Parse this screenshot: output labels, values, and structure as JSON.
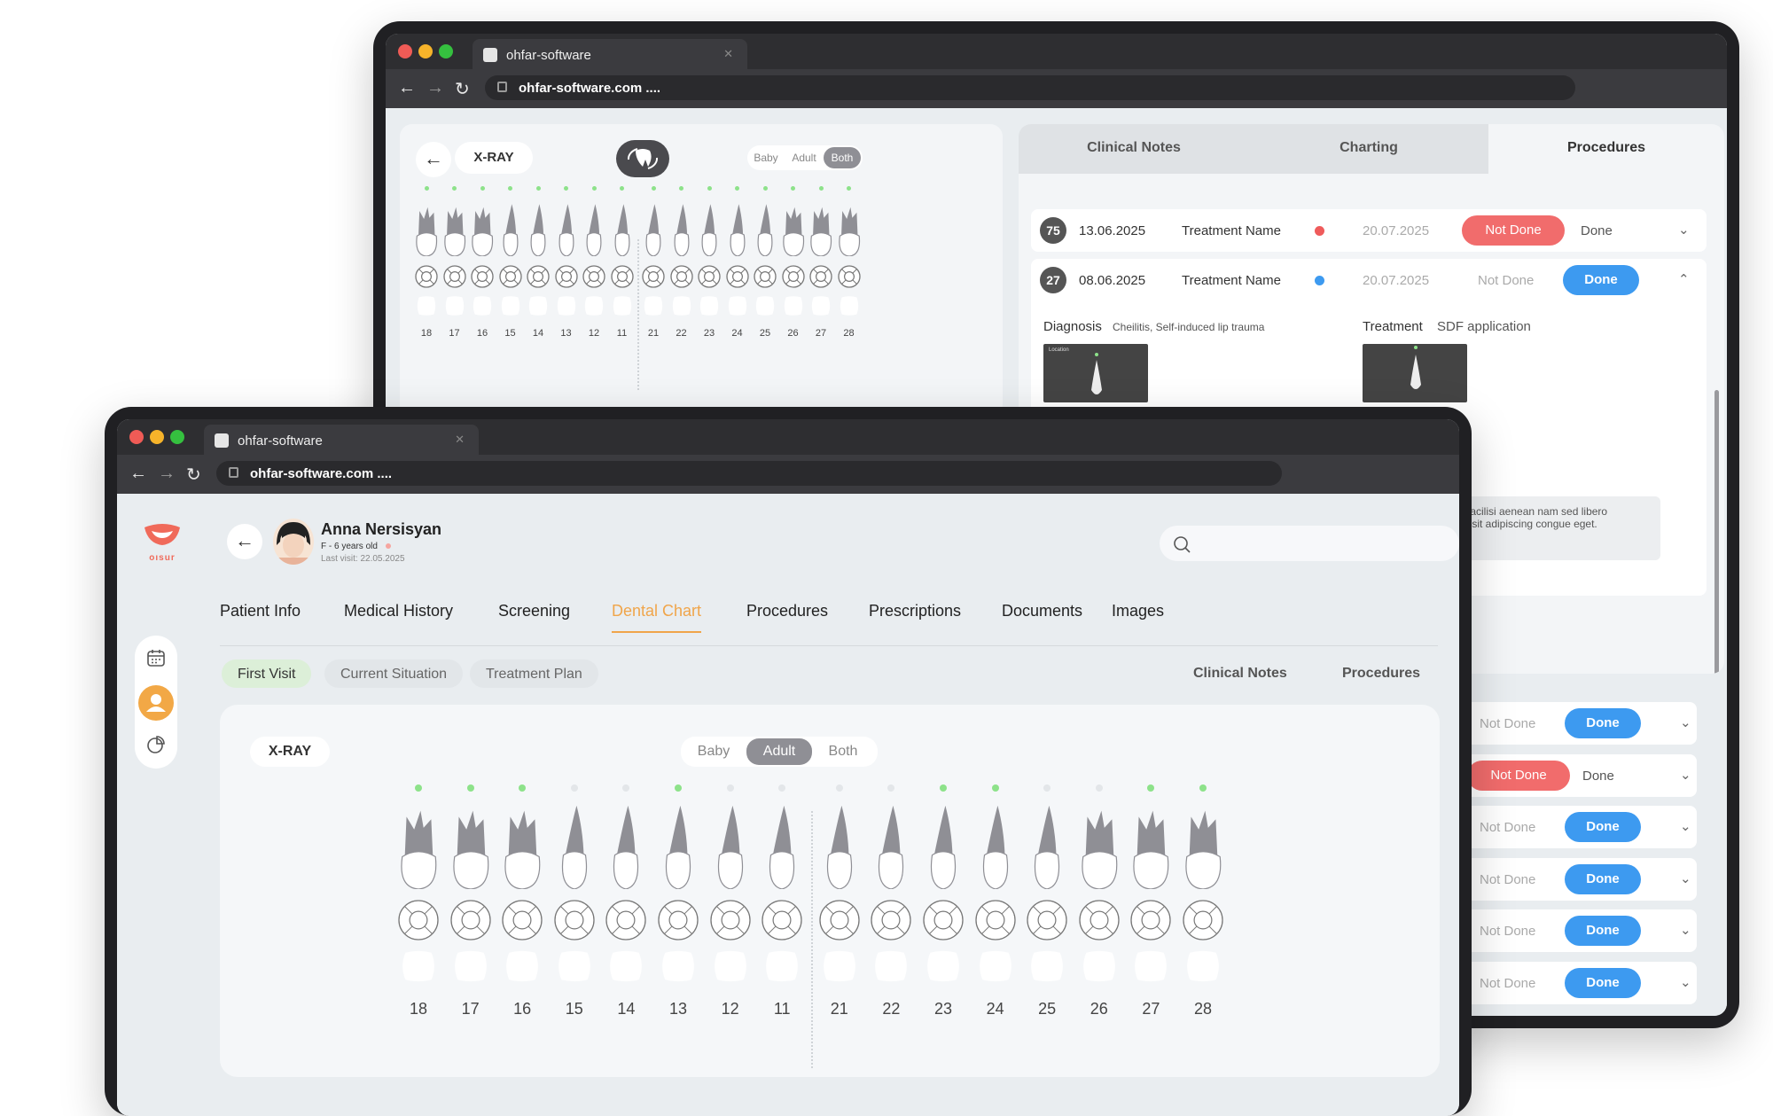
{
  "browser": {
    "tab_title": "ohfar-software",
    "url": "ohfar-software.com ...."
  },
  "back_window": {
    "xray_label": "X-RAY",
    "toggle": [
      "Baby",
      "Adult",
      "Both"
    ],
    "toggle_selected": "Both",
    "teeth": [
      "18",
      "17",
      "16",
      "15",
      "14",
      "13",
      "12",
      "11",
      "21",
      "22",
      "23",
      "24",
      "25",
      "26",
      "27",
      "28"
    ],
    "right_tabs": [
      "Clinical Notes",
      "Charting",
      "Procedures"
    ],
    "right_tab_active": "Procedures",
    "procedures": [
      {
        "tooth": "75",
        "date": "13.06.2025",
        "name": "Treatment Name",
        "dot_color": "#ef5b5b",
        "due": "20.07.2025",
        "not_done": "Not Done",
        "done": "Done",
        "status": "not_done"
      },
      {
        "tooth": "27",
        "date": "08.06.2025",
        "name": "Treatment Name",
        "dot_color": "#3d9af0",
        "due": "20.07.2025",
        "not_done": "Not Done",
        "done": "Done",
        "status": "done"
      }
    ],
    "diagnosis_label": "Diagnosis",
    "diagnosis_values": "Cheilitis,  Self-induced lip trauma",
    "treatment_label": "Treatment",
    "treatment_value": "SDF application",
    "xray_location": "Location",
    "note_text_1": "Facilisi aenean nam sed libero",
    "note_text_2": "c sit adipiscing congue eget.",
    "more_rows": [
      {
        "not_done": "Not Done",
        "done": "Done",
        "status": "done"
      },
      {
        "not_done": "Not Done",
        "done": "Done",
        "status": "not_done"
      },
      {
        "not_done": "Not Done",
        "done": "Done",
        "status": "done"
      },
      {
        "not_done": "Not Done",
        "done": "Done",
        "status": "done"
      },
      {
        "not_done": "Not Done",
        "done": "Done",
        "status": "done"
      },
      {
        "not_done": "Not Done",
        "done": "Done",
        "status": "done"
      }
    ]
  },
  "front_window": {
    "logo_text": "oısur",
    "patient": {
      "name": "Anna Nersisyan",
      "info": "F - 6 years old",
      "last_visit": "Last visit: 22.05.2025"
    },
    "nav_tabs": [
      "Patient Info",
      "Medical History",
      "Screening",
      "Dental Chart",
      "Procedures",
      "Prescriptions",
      "Documents",
      "Images"
    ],
    "nav_active": "Dental Chart",
    "sub_tabs": [
      "First Visit",
      "Current Situation",
      "Treatment  Plan"
    ],
    "sub_active": "First Visit",
    "right_links": [
      "Clinical Notes",
      "Procedures"
    ],
    "xray_label": "X-RAY",
    "toggle": [
      "Baby",
      "Adult",
      "Both"
    ],
    "toggle_selected": "Adult",
    "teeth": [
      "18",
      "17",
      "16",
      "15",
      "14",
      "13",
      "12",
      "11",
      "21",
      "22",
      "23",
      "24",
      "25",
      "26",
      "27",
      "28"
    ],
    "teeth_marked": [
      true,
      true,
      true,
      false,
      false,
      true,
      false,
      false,
      false,
      false,
      true,
      true,
      false,
      false,
      true,
      true
    ]
  },
  "colors": {
    "accent": "#f0a54a",
    "done": "#3d9af0",
    "not_done": "#f16c6c",
    "marker": "#8de28a"
  }
}
